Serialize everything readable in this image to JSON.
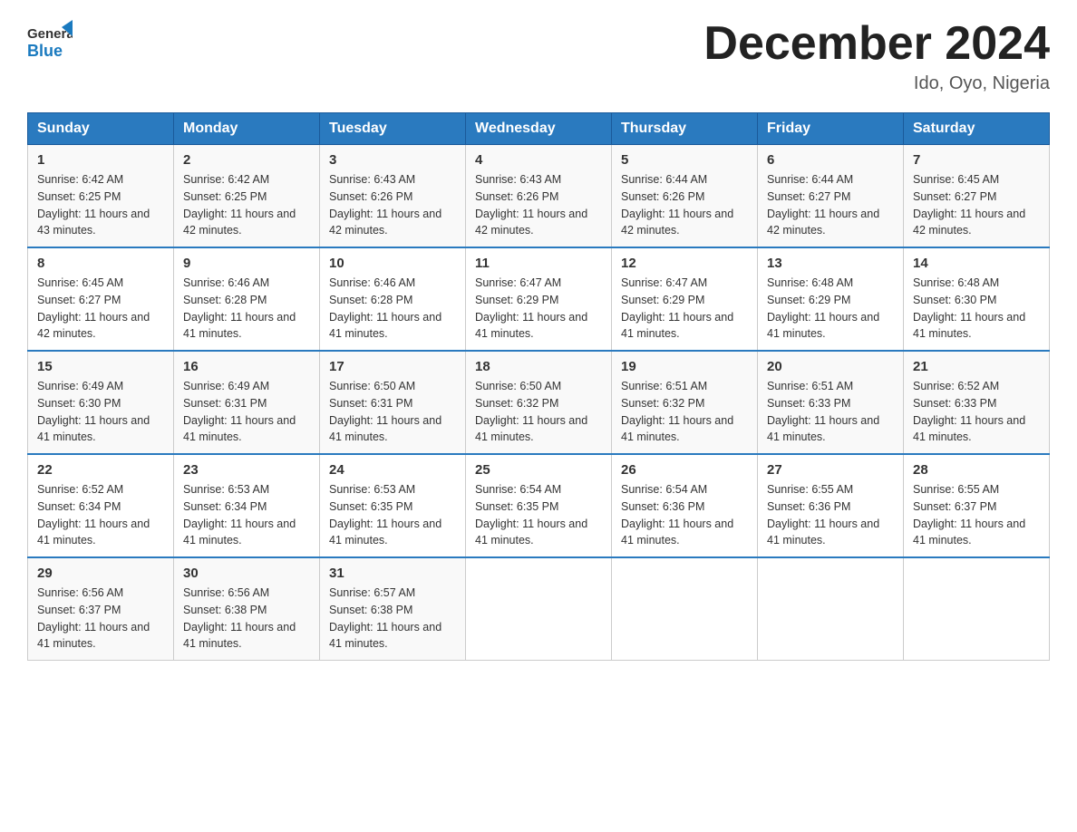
{
  "header": {
    "logo_text_general": "General",
    "logo_text_blue": "Blue",
    "month_title": "December 2024",
    "location": "Ido, Oyo, Nigeria"
  },
  "days_of_week": [
    "Sunday",
    "Monday",
    "Tuesday",
    "Wednesday",
    "Thursday",
    "Friday",
    "Saturday"
  ],
  "weeks": [
    [
      {
        "day": "1",
        "sunrise": "6:42 AM",
        "sunset": "6:25 PM",
        "daylight": "11 hours and 43 minutes."
      },
      {
        "day": "2",
        "sunrise": "6:42 AM",
        "sunset": "6:25 PM",
        "daylight": "11 hours and 42 minutes."
      },
      {
        "day": "3",
        "sunrise": "6:43 AM",
        "sunset": "6:26 PM",
        "daylight": "11 hours and 42 minutes."
      },
      {
        "day": "4",
        "sunrise": "6:43 AM",
        "sunset": "6:26 PM",
        "daylight": "11 hours and 42 minutes."
      },
      {
        "day": "5",
        "sunrise": "6:44 AM",
        "sunset": "6:26 PM",
        "daylight": "11 hours and 42 minutes."
      },
      {
        "day": "6",
        "sunrise": "6:44 AM",
        "sunset": "6:27 PM",
        "daylight": "11 hours and 42 minutes."
      },
      {
        "day": "7",
        "sunrise": "6:45 AM",
        "sunset": "6:27 PM",
        "daylight": "11 hours and 42 minutes."
      }
    ],
    [
      {
        "day": "8",
        "sunrise": "6:45 AM",
        "sunset": "6:27 PM",
        "daylight": "11 hours and 42 minutes."
      },
      {
        "day": "9",
        "sunrise": "6:46 AM",
        "sunset": "6:28 PM",
        "daylight": "11 hours and 41 minutes."
      },
      {
        "day": "10",
        "sunrise": "6:46 AM",
        "sunset": "6:28 PM",
        "daylight": "11 hours and 41 minutes."
      },
      {
        "day": "11",
        "sunrise": "6:47 AM",
        "sunset": "6:29 PM",
        "daylight": "11 hours and 41 minutes."
      },
      {
        "day": "12",
        "sunrise": "6:47 AM",
        "sunset": "6:29 PM",
        "daylight": "11 hours and 41 minutes."
      },
      {
        "day": "13",
        "sunrise": "6:48 AM",
        "sunset": "6:29 PM",
        "daylight": "11 hours and 41 minutes."
      },
      {
        "day": "14",
        "sunrise": "6:48 AM",
        "sunset": "6:30 PM",
        "daylight": "11 hours and 41 minutes."
      }
    ],
    [
      {
        "day": "15",
        "sunrise": "6:49 AM",
        "sunset": "6:30 PM",
        "daylight": "11 hours and 41 minutes."
      },
      {
        "day": "16",
        "sunrise": "6:49 AM",
        "sunset": "6:31 PM",
        "daylight": "11 hours and 41 minutes."
      },
      {
        "day": "17",
        "sunrise": "6:50 AM",
        "sunset": "6:31 PM",
        "daylight": "11 hours and 41 minutes."
      },
      {
        "day": "18",
        "sunrise": "6:50 AM",
        "sunset": "6:32 PM",
        "daylight": "11 hours and 41 minutes."
      },
      {
        "day": "19",
        "sunrise": "6:51 AM",
        "sunset": "6:32 PM",
        "daylight": "11 hours and 41 minutes."
      },
      {
        "day": "20",
        "sunrise": "6:51 AM",
        "sunset": "6:33 PM",
        "daylight": "11 hours and 41 minutes."
      },
      {
        "day": "21",
        "sunrise": "6:52 AM",
        "sunset": "6:33 PM",
        "daylight": "11 hours and 41 minutes."
      }
    ],
    [
      {
        "day": "22",
        "sunrise": "6:52 AM",
        "sunset": "6:34 PM",
        "daylight": "11 hours and 41 minutes."
      },
      {
        "day": "23",
        "sunrise": "6:53 AM",
        "sunset": "6:34 PM",
        "daylight": "11 hours and 41 minutes."
      },
      {
        "day": "24",
        "sunrise": "6:53 AM",
        "sunset": "6:35 PM",
        "daylight": "11 hours and 41 minutes."
      },
      {
        "day": "25",
        "sunrise": "6:54 AM",
        "sunset": "6:35 PM",
        "daylight": "11 hours and 41 minutes."
      },
      {
        "day": "26",
        "sunrise": "6:54 AM",
        "sunset": "6:36 PM",
        "daylight": "11 hours and 41 minutes."
      },
      {
        "day": "27",
        "sunrise": "6:55 AM",
        "sunset": "6:36 PM",
        "daylight": "11 hours and 41 minutes."
      },
      {
        "day": "28",
        "sunrise": "6:55 AM",
        "sunset": "6:37 PM",
        "daylight": "11 hours and 41 minutes."
      }
    ],
    [
      {
        "day": "29",
        "sunrise": "6:56 AM",
        "sunset": "6:37 PM",
        "daylight": "11 hours and 41 minutes."
      },
      {
        "day": "30",
        "sunrise": "6:56 AM",
        "sunset": "6:38 PM",
        "daylight": "11 hours and 41 minutes."
      },
      {
        "day": "31",
        "sunrise": "6:57 AM",
        "sunset": "6:38 PM",
        "daylight": "11 hours and 41 minutes."
      },
      null,
      null,
      null,
      null
    ]
  ]
}
